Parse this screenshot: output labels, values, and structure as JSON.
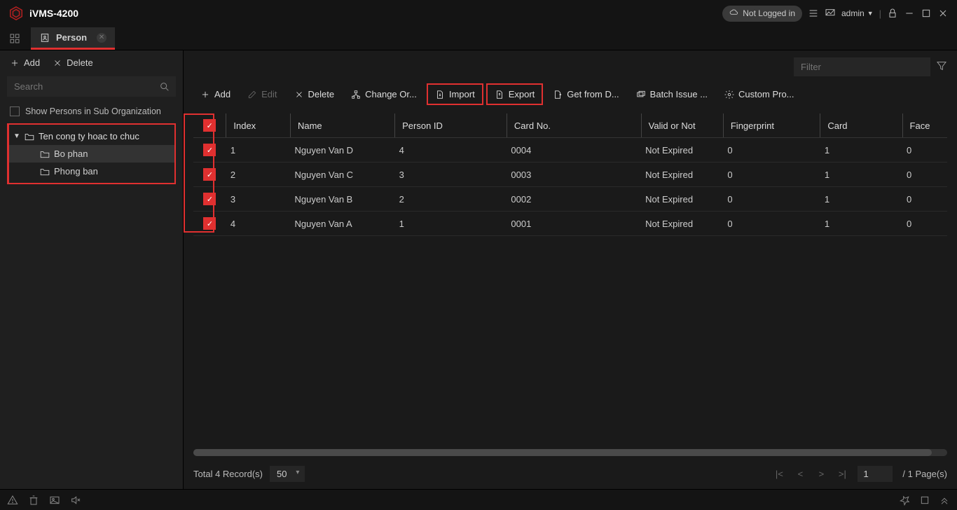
{
  "app": {
    "title": "iVMS-4200"
  },
  "titlebar": {
    "login_status": "Not Logged in",
    "user_label": "admin"
  },
  "tab": {
    "label": "Person"
  },
  "sidebar": {
    "add_label": "Add",
    "delete_label": "Delete",
    "search_placeholder": "Search",
    "sub_org_label": "Show Persons in Sub Organization",
    "tree": {
      "root": "Ten cong ty hoac to chuc",
      "children": [
        "Bo phan",
        "Phong ban"
      ]
    }
  },
  "filter": {
    "placeholder": "Filter"
  },
  "toolbar": {
    "add": "Add",
    "edit": "Edit",
    "delete": "Delete",
    "change_org": "Change Or...",
    "import": "Import",
    "export": "Export",
    "get_from_device": "Get from D...",
    "batch_issue": "Batch Issue ...",
    "custom_prop": "Custom Pro..."
  },
  "table": {
    "headers": {
      "index": "Index",
      "name": "Name",
      "person_id": "Person ID",
      "card_no": "Card No.",
      "valid": "Valid or Not",
      "fingerprint": "Fingerprint",
      "card": "Card",
      "face": "Face"
    },
    "rows": [
      {
        "index": "1",
        "name": "Nguyen Van D",
        "person_id": "4",
        "card_no": "0004",
        "valid": "Not Expired",
        "fingerprint": "0",
        "card": "1",
        "face": "0"
      },
      {
        "index": "2",
        "name": "Nguyen Van C",
        "person_id": "3",
        "card_no": "0003",
        "valid": "Not Expired",
        "fingerprint": "0",
        "card": "1",
        "face": "0"
      },
      {
        "index": "3",
        "name": "Nguyen Van B",
        "person_id": "2",
        "card_no": "0002",
        "valid": "Not Expired",
        "fingerprint": "0",
        "card": "1",
        "face": "0"
      },
      {
        "index": "4",
        "name": "Nguyen Van A",
        "person_id": "1",
        "card_no": "0001",
        "valid": "Not Expired",
        "fingerprint": "0",
        "card": "1",
        "face": "0"
      }
    ]
  },
  "footer": {
    "total_label": "Total 4 Record(s)",
    "page_size": "50",
    "current_page": "1",
    "page_total": "/ 1 Page(s)"
  }
}
